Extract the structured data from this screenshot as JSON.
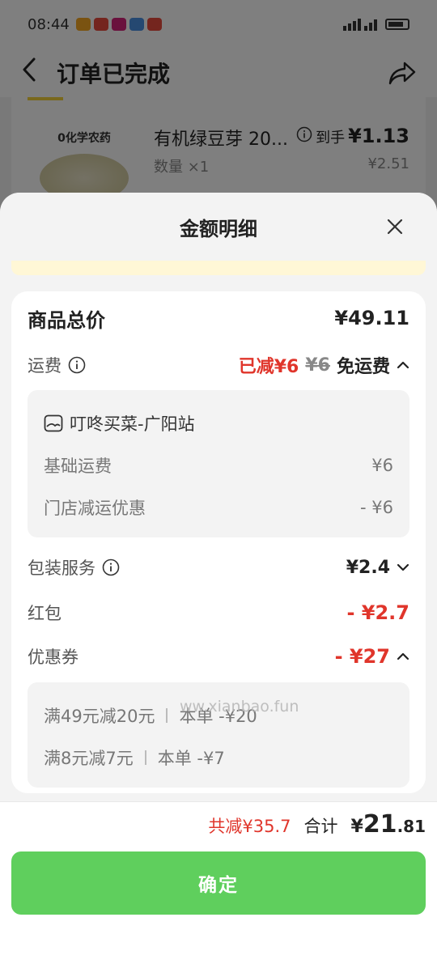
{
  "status_bar": {
    "time": "08:44"
  },
  "nav": {
    "title": "订单已完成"
  },
  "product": {
    "thumb_tag": "0化学农药",
    "name": "有机绿豆芽 20...",
    "quantity": "数量 ×1",
    "final_label": "到手",
    "final_price": "¥1.13",
    "original_price": "¥2.51"
  },
  "sheet": {
    "title": "金额明细"
  },
  "details": {
    "goods_total_label": "商品总价",
    "goods_total_value": "¥49.11",
    "shipping_label": "运费",
    "shipping_saved": "已减¥6",
    "shipping_original": "¥6",
    "shipping_free": "免运费",
    "shipping_items": {
      "store": "叮咚买菜-广阳站",
      "base_label": "基础运费",
      "base_value": "¥6",
      "discount_label": "门店减运优惠",
      "discount_value": "- ¥6"
    },
    "packaging_label": "包装服务",
    "packaging_value": "¥2.4",
    "redpacket_label": "红包",
    "redpacket_value": "- ¥2.7",
    "coupon_label": "优惠券",
    "coupon_value": "- ¥27",
    "coupons": [
      {
        "rule": "满49元减20元",
        "applied": "本单 -¥20"
      },
      {
        "rule": "满8元减7元",
        "applied": "本单 -¥7"
      }
    ]
  },
  "watermark": "ww.xianbao.fun",
  "footer": {
    "saved": "共减¥35.7",
    "total_label": "合计",
    "currency": "¥",
    "total_int": "21",
    "total_dec": ".81",
    "confirm_label": "确定"
  },
  "colors": {
    "accent_green": "#5fcf5d",
    "discount_red": "#e0352b"
  }
}
